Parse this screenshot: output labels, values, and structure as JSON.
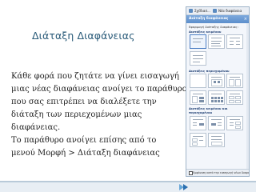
{
  "slide": {
    "title": "Διάταξη Διαφάνειας",
    "paragraph_lines": [
      "Κάθε φορά που ζητάτε να γίνει εισαγωγή",
      "μιας νέας διαφάνειας ανοίγει το παράθυρο",
      "που σας επιτρέπει να διαλέξετε την",
      "διάταξη των περιεχομένων μιας",
      "διαφάνειας.",
      "Το παράθυρο ανοίγει επίσης από το",
      "μενού Μορφή > Διάταξη διαφάνειας"
    ]
  },
  "task_pane": {
    "toolbar_items": [
      "Σχέδιασ...",
      "Νέα διαφάνεια"
    ],
    "title": "Διάταξη διαφάνειας",
    "subtitle": "Εφαρμογή διάταξης διαφάνειας:",
    "sections": [
      "Διατάξεις κειμένου",
      "Διατάξεις περιεχομένου",
      "Διατάξεις κειμένου και περιεχομένου"
    ],
    "footer_checkbox_label": "Εμφάνιση κατά την εισαγωγή νέων διαφανειών"
  },
  "colors": {
    "title": "#2b5c7a",
    "pane_header": "#5c8ecb",
    "bottom_accent": "#2a6fb0"
  }
}
